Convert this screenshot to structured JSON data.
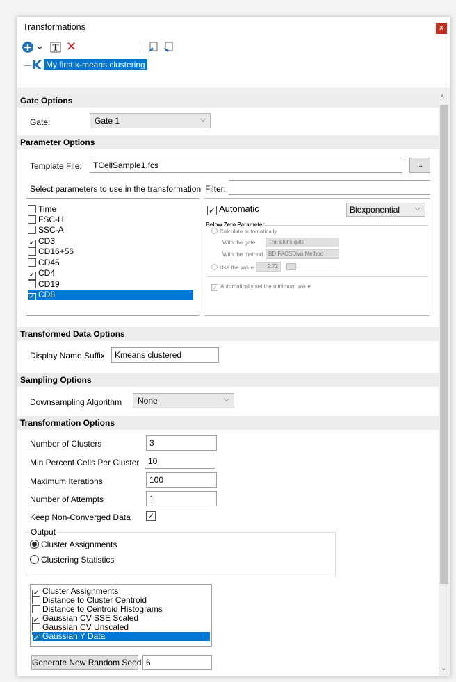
{
  "window": {
    "title": "Transformations",
    "close_glyph": "x"
  },
  "toolbar": {
    "icons": [
      "add-icon",
      "dropdown-chevron-icon",
      "text-icon",
      "delete-icon",
      "move-up-icon",
      "move-down-icon"
    ],
    "delete_glyph": "✕"
  },
  "tree": {
    "item_glyph": "K",
    "item_label": "My first k-means clustering"
  },
  "gate_options": {
    "header": "Gate Options",
    "gate_label": "Gate:",
    "gate_value": "Gate 1"
  },
  "parameter_options": {
    "header": "Parameter Options",
    "template_label": "Template File:",
    "template_value": "TCellSample1.fcs",
    "browse_label": "...",
    "select_label": "Select parameters to use in the transformation",
    "filter_label": "Filter:",
    "filter_value": "",
    "parameters": [
      {
        "label": "Time",
        "checked": false,
        "selected": false
      },
      {
        "label": "FSC-H",
        "checked": false,
        "selected": false
      },
      {
        "label": "SSC-A",
        "checked": false,
        "selected": false
      },
      {
        "label": "CD3",
        "checked": true,
        "selected": false
      },
      {
        "label": "CD16+56",
        "checked": false,
        "selected": false
      },
      {
        "label": "CD45",
        "checked": false,
        "selected": false
      },
      {
        "label": "CD4",
        "checked": true,
        "selected": false
      },
      {
        "label": "CD19",
        "checked": false,
        "selected": false
      },
      {
        "label": "CD8",
        "checked": true,
        "selected": true
      }
    ],
    "automatic_label": "Automatic",
    "scale_value": "Biexponential",
    "below_zero_label": "Below Zero Parameter",
    "calc_auto_label": "Calculate automatically",
    "with_gate_label": "With the gate",
    "gate_combo_value": "The plot's gate",
    "with_method_label": "With the method",
    "method_combo_value": "BD FACSDiva Method",
    "use_value_label": "Use the value",
    "use_value_value": "2.72",
    "auto_min_label": "Automatically set the minimum value"
  },
  "transformed_data_options": {
    "header": "Transformed Data Options",
    "suffix_label": "Display Name Suffix",
    "suffix_value": "Kmeans clustered"
  },
  "sampling_options": {
    "header": "Sampling Options",
    "downsampling_label": "Downsampling Algorithm",
    "downsampling_value": "None"
  },
  "transformation_options": {
    "header": "Transformation Options",
    "fields": [
      {
        "label": "Number of Clusters",
        "value": "3"
      },
      {
        "label": "Min Percent Cells Per Cluster",
        "value": "10"
      },
      {
        "label": "Maximum Iterations",
        "value": "100"
      },
      {
        "label": "Number of Attempts",
        "value": "1"
      }
    ],
    "keep_label": "Keep Non-Converged Data",
    "keep_checked": true,
    "output_label": "Output",
    "output_options": [
      {
        "label": "Cluster Assignments",
        "selected": true
      },
      {
        "label": "Clustering Statistics",
        "selected": false
      }
    ],
    "outputs_list": [
      {
        "label": "Cluster Assignments",
        "checked": true,
        "selected": false
      },
      {
        "label": "Distance to Cluster Centroid",
        "checked": false,
        "selected": false
      },
      {
        "label": "Distance to Centroid Histograms",
        "checked": false,
        "selected": false
      },
      {
        "label": "Gaussian CV SSE Scaled",
        "checked": true,
        "selected": false
      },
      {
        "label": "Gaussian CV Unscaled",
        "checked": false,
        "selected": false
      },
      {
        "label": "Gaussian Y Data",
        "checked": true,
        "selected": true
      }
    ],
    "seed_button_label": "Generate New Random Seed",
    "seed_value": "6"
  },
  "glyphs": {
    "check": "✓",
    "chevron_down": "⌵",
    "scroll_up": "^",
    "scroll_down": "⌄"
  },
  "colors": {
    "selection": "#0078d7",
    "close": "#c42b1c",
    "header_bg": "#ececec"
  }
}
